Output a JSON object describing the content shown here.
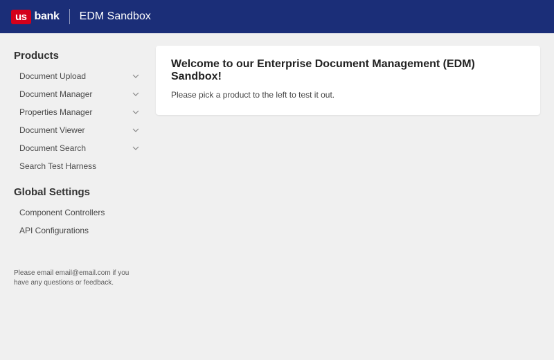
{
  "header": {
    "logo_us": "us",
    "logo_bank": "bank",
    "title": "EDM Sandbox"
  },
  "sidebar": {
    "products_header": "Products",
    "products": [
      {
        "label": "Document Upload",
        "expandable": true
      },
      {
        "label": "Document Manager",
        "expandable": true
      },
      {
        "label": "Properties Manager",
        "expandable": true
      },
      {
        "label": "Document Viewer",
        "expandable": true
      },
      {
        "label": "Document Search",
        "expandable": true
      },
      {
        "label": "Search Test Harness",
        "expandable": false
      }
    ],
    "global_header": "Global Settings",
    "global": [
      {
        "label": "Component Controllers"
      },
      {
        "label": "API Configurations"
      }
    ],
    "footer": "Please email email@email.com if you have any questions or feedback."
  },
  "main": {
    "welcome_title": "Welcome to our Enterprise Document Management (EDM) Sandbox!",
    "welcome_body": "Please pick a product to the left to test it out."
  }
}
